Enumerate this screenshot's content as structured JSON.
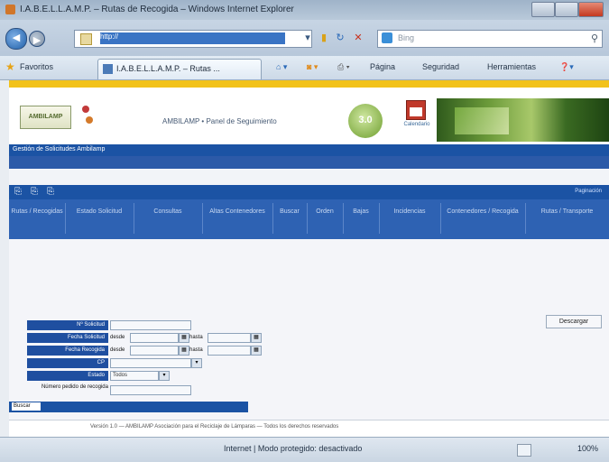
{
  "window": {
    "title": "I.A.B.E.L.L.A.M.P. – Rutas de Recogida – Windows Internet Explorer"
  },
  "address": {
    "url": "http://",
    "search_placeholder": "Bing"
  },
  "favorites": {
    "label": "Favoritos",
    "tab_label": "I.A.B.E.L.L.A.M.P. – Rutas ...",
    "commands": [
      "Página",
      "Seguridad",
      "Herramientas"
    ]
  },
  "site": {
    "logo_text": "AMBILAMP",
    "header_title": "AMBILAMP • Panel de Seguimiento",
    "gear_text": "3.0",
    "calendar_caption": "Calendario",
    "breadcrumb": "Gestión de Solicitudes Ambilamp",
    "toolbar_right": "Paginación"
  },
  "menu": {
    "items": [
      "Rutas / Recogidas",
      "Estado Solicitud",
      "Consultas",
      "Altas Contenedores",
      "Buscar",
      "Orden",
      "Bajas",
      "Incidencias",
      "Contenedores / Recogida",
      "Rutas / Transporte"
    ]
  },
  "form": {
    "rows": [
      {
        "label": "Nº Solicitud"
      },
      {
        "label": "Fecha Solicitud",
        "from": "desde",
        "to": "hasta"
      },
      {
        "label": "Fecha Recogida",
        "from": "desde",
        "to": "hasta"
      },
      {
        "label": "CP"
      },
      {
        "label": "Estado",
        "value": "Todos"
      }
    ],
    "extra_label": "Número pedido de recogida",
    "results_button": "Buscar",
    "right_button": "Descargar"
  },
  "footer": {
    "text": "Versión 1.0 — AMBILAMP Asociación para el Reciclaje de Lámparas — Todos los derechos reservados"
  },
  "status": {
    "text": "Internet | Modo protegido: desactivado",
    "zoom": "100%"
  }
}
